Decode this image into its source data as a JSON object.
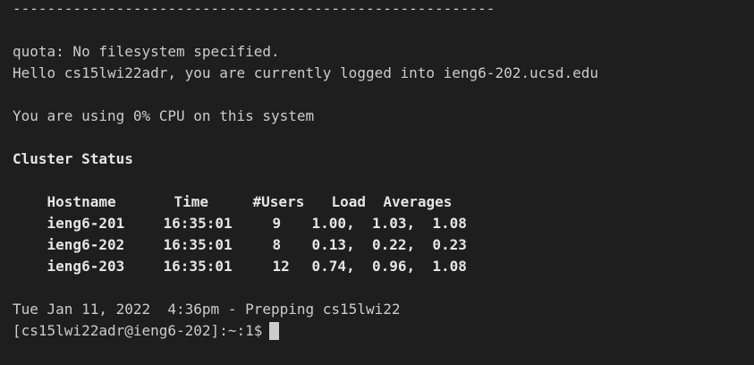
{
  "terminal": {
    "separator": "--------------------------------------------------------",
    "quota": "quota: No filesystem specified.",
    "hello": "Hello cs15lwi22adr, you are currently logged into ieng6-202.ucsd.edu",
    "cpu": "You are using 0% CPU on this system",
    "cluster_title": "Cluster Status",
    "headers": {
      "hostname": "Hostname",
      "time": "Time",
      "users": "#Users",
      "load": "Load  Averages"
    },
    "rows": [
      {
        "host": "ieng6-201",
        "time": "16:35:01",
        "users": "9",
        "load": "1.00,  1.03,  1.08"
      },
      {
        "host": "ieng6-202",
        "time": "16:35:01",
        "users": "8",
        "load": "0.13,  0.22,  0.23"
      },
      {
        "host": "ieng6-203",
        "time": "16:35:01",
        "users": "12",
        "load": "0.74,  0.96,  1.08"
      }
    ],
    "date_line": "Tue Jan 11, 2022  4:36pm - Prepping cs15lwi22",
    "prompt": "[cs15lwi22adr@ieng6-202]:~:1$"
  },
  "colors": {
    "background": "#1e1e1e",
    "text": "#cccccc",
    "bold_text": "#e5e5e5"
  }
}
